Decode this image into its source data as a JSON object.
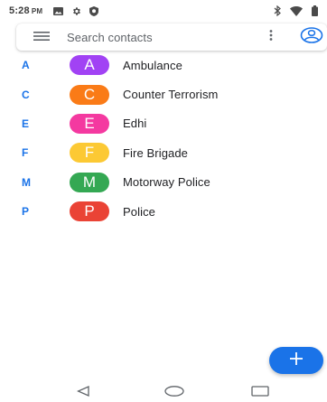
{
  "status_bar": {
    "time": "5:28",
    "ampm": "PM",
    "left_icons": [
      "gallery-icon",
      "gear-icon",
      "shield-icon"
    ],
    "right_icons": [
      "bluetooth-icon",
      "wifi-icon",
      "battery-icon"
    ]
  },
  "search": {
    "placeholder": "Search contacts",
    "menu_icon": "hamburger-menu-icon",
    "more_icon": "more-vertical-icon",
    "account_icon": "account-circle-icon"
  },
  "contacts": [
    {
      "section": "A",
      "initial": "A",
      "name": "Ambulance",
      "color": "#a142f4"
    },
    {
      "section": "C",
      "initial": "C",
      "name": "Counter Terrorism",
      "color": "#fa7b17"
    },
    {
      "section": "E",
      "initial": "E",
      "name": "Edhi",
      "color": "#f439a0"
    },
    {
      "section": "F",
      "initial": "F",
      "name": "Fire Brigade",
      "color": "#fcc934"
    },
    {
      "section": "M",
      "initial": "M",
      "name": "Motorway Police",
      "color": "#34a853"
    },
    {
      "section": "P",
      "initial": "P",
      "name": "Police",
      "color": "#ea4335"
    }
  ],
  "fab": {
    "icon": "plus-icon",
    "color": "#1a73e8"
  },
  "nav_bar": {
    "icons": [
      "back-triangle-icon",
      "home-circle-icon",
      "recents-square-icon"
    ]
  },
  "colors": {
    "accent": "#1a73e8",
    "text_primary": "#202124",
    "text_secondary": "#5f6368"
  }
}
